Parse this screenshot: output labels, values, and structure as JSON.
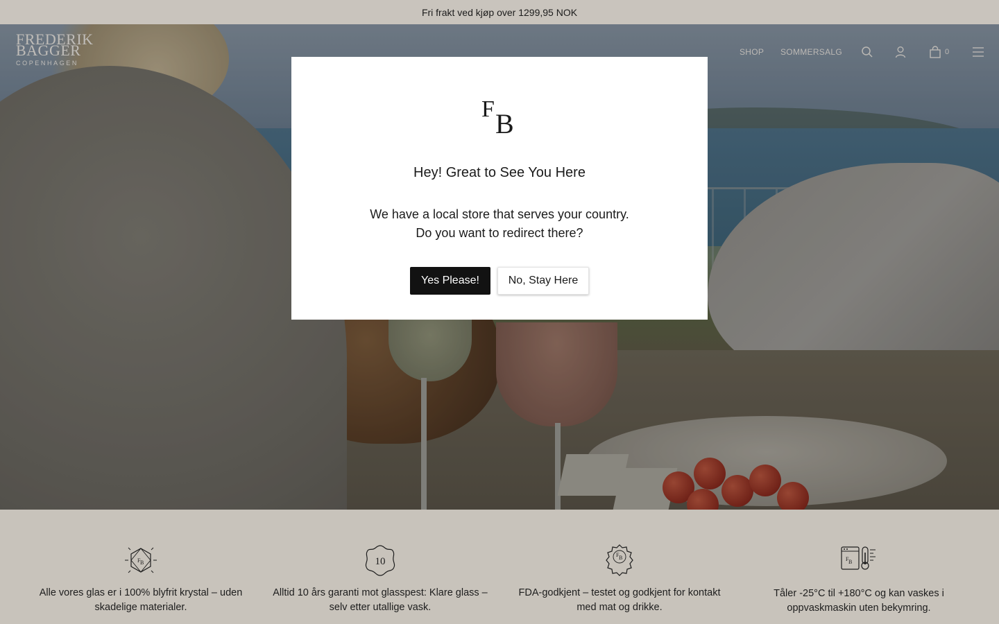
{
  "announcement": "Fri frakt ved kjøp over 1299,95 NOK",
  "header": {
    "logo": {
      "line1": "FREDERIK",
      "line2": "BAGGER",
      "line3": "COPENHAGEN"
    },
    "nav": {
      "shop": "SHOP",
      "sale": "SOMMERSALG"
    },
    "icons": [
      "search-icon",
      "account-icon",
      "cart-icon",
      "menu-icon"
    ],
    "cart_count": "0"
  },
  "modal": {
    "logo_text": "FB",
    "title": "Hey! Great to See You Here",
    "line1": "We have a local store that serves your country.",
    "line2": "Do you want to redirect there?",
    "yes_label": "Yes Please!",
    "no_label": "No, Stay Here"
  },
  "features": [
    {
      "icon": "crystal-icon",
      "text": "Alle vores glas er i 100% blyfrit krystal – uden skadelige materialer."
    },
    {
      "icon": "ten-year-badge-icon",
      "badge": "10",
      "text": "Alltid 10 års garanti mot glasspest: Klare glass – selv etter utallige vask."
    },
    {
      "icon": "fda-seal-icon",
      "text": "FDA-godkjent – testet og godkjent for kontakt med mat og drikke."
    },
    {
      "icon": "temperature-dishwasher-icon",
      "text": "Tåler -25°C til +180°C og kan vaskes i oppvaskmaskin uten bekymring."
    }
  ],
  "colors": {
    "announcement_bg": "#c9c4bd",
    "primary_button": "#121212",
    "features_bg": "#c8c3bb"
  }
}
